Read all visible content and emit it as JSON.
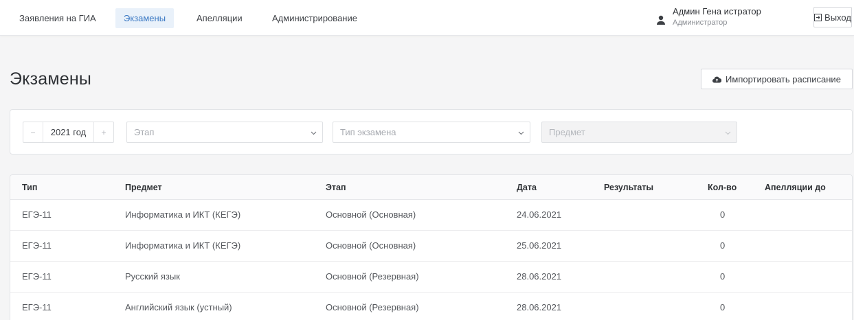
{
  "nav": {
    "items": [
      {
        "label": "Заявления на ГИА",
        "active": false
      },
      {
        "label": "Экзамены",
        "active": true
      },
      {
        "label": "Апелляции",
        "active": false
      },
      {
        "label": "Администрирование",
        "active": false
      }
    ]
  },
  "user": {
    "name": "Админ Гена истратор",
    "role": "Администратор",
    "icon": "user-icon"
  },
  "logout": {
    "label": "Выход",
    "icon": "logout-icon"
  },
  "page": {
    "title": "Экзамены"
  },
  "import_button": {
    "label": "Импортировать расписание",
    "icon": "cloud-upload-icon"
  },
  "filters": {
    "year": {
      "value": "2021 год",
      "minus": "−",
      "plus": "+"
    },
    "stage": {
      "placeholder": "Этап"
    },
    "exam_type": {
      "placeholder": "Тип экзамена"
    },
    "subject": {
      "placeholder": "Предмет",
      "disabled": true
    }
  },
  "table": {
    "columns": [
      "Тип",
      "Предмет",
      "Этап",
      "Дата",
      "Результаты",
      "Кол-во",
      "Апелляции до"
    ],
    "rows": [
      {
        "type": "ЕГЭ-11",
        "subject": "Информатика и ИКТ (КЕГЭ)",
        "stage": "Основной (Основная)",
        "date": "24.06.2021",
        "results": "",
        "count": "0",
        "appeal_until": ""
      },
      {
        "type": "ЕГЭ-11",
        "subject": "Информатика и ИКТ (КЕГЭ)",
        "stage": "Основной (Основная)",
        "date": "25.06.2021",
        "results": "",
        "count": "0",
        "appeal_until": ""
      },
      {
        "type": "ЕГЭ-11",
        "subject": "Русский язык",
        "stage": "Основной (Резервная)",
        "date": "28.06.2021",
        "results": "",
        "count": "0",
        "appeal_until": ""
      },
      {
        "type": "ЕГЭ-11",
        "subject": "Английский язык (устный)",
        "stage": "Основной (Резервная)",
        "date": "28.06.2021",
        "results": "",
        "count": "0",
        "appeal_until": ""
      }
    ]
  },
  "colors": {
    "accent": "#3a78c3",
    "active_tab_bg": "#e9f1fa",
    "page_bg": "#f5f5f6"
  }
}
